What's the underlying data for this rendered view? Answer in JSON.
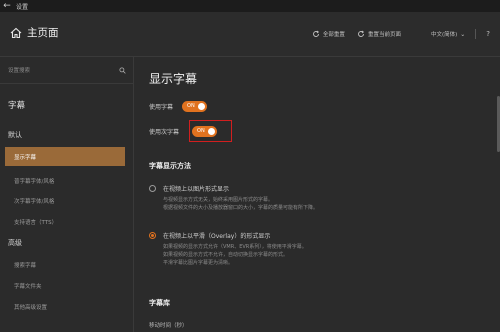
{
  "window": {
    "title": "设置"
  },
  "header": {
    "home_label": "主页面",
    "reset_all": "全部重置",
    "reset_page": "重置当前页面",
    "language": "中文(简体)",
    "help": "?"
  },
  "sidebar": {
    "search_placeholder": "设置搜索",
    "category": "字幕",
    "groups": [
      {
        "label": "默认",
        "items": [
          "显示字幕",
          "普字幕字体/风格",
          "次字幕字体/风格",
          "支持语言（TTS）"
        ]
      },
      {
        "label": "高级",
        "items": [
          "搜索字幕",
          "字幕文件夹",
          "其他高级设置"
        ]
      }
    ],
    "active_item": "显示字幕"
  },
  "main": {
    "title": "显示字幕",
    "toggles": [
      {
        "label": "使用字幕",
        "state": "ON"
      },
      {
        "label": "使用次字幕",
        "state": "ON"
      }
    ],
    "display_method": {
      "heading": "字幕显示方法",
      "options": [
        {
          "label": "在视频上以图片形式显示",
          "selected": false,
          "desc": [
            "与视频显示方式无关，始终采用图片形式的字幕。",
            "根据视频文件的大小及播放器窗口的大小，字幕的质量可能有所下降。"
          ]
        },
        {
          "label": "在视频上以平滑（Overlay）的形式显示",
          "selected": true,
          "desc": [
            "如果视频的显示方式允许（VMR、EVR系列），将使用平滑字幕。",
            "如果视频的显示方式不允许，自动切换显示字幕的形式。",
            "平滑字幕比图片字幕更为清晰。"
          ]
        }
      ]
    },
    "library": {
      "heading": "字幕库",
      "item": "移动时间（秒）"
    }
  },
  "colors": {
    "accent": "#e0721f",
    "active_nav": "#9a6a39",
    "highlight": "#d21f1f"
  }
}
